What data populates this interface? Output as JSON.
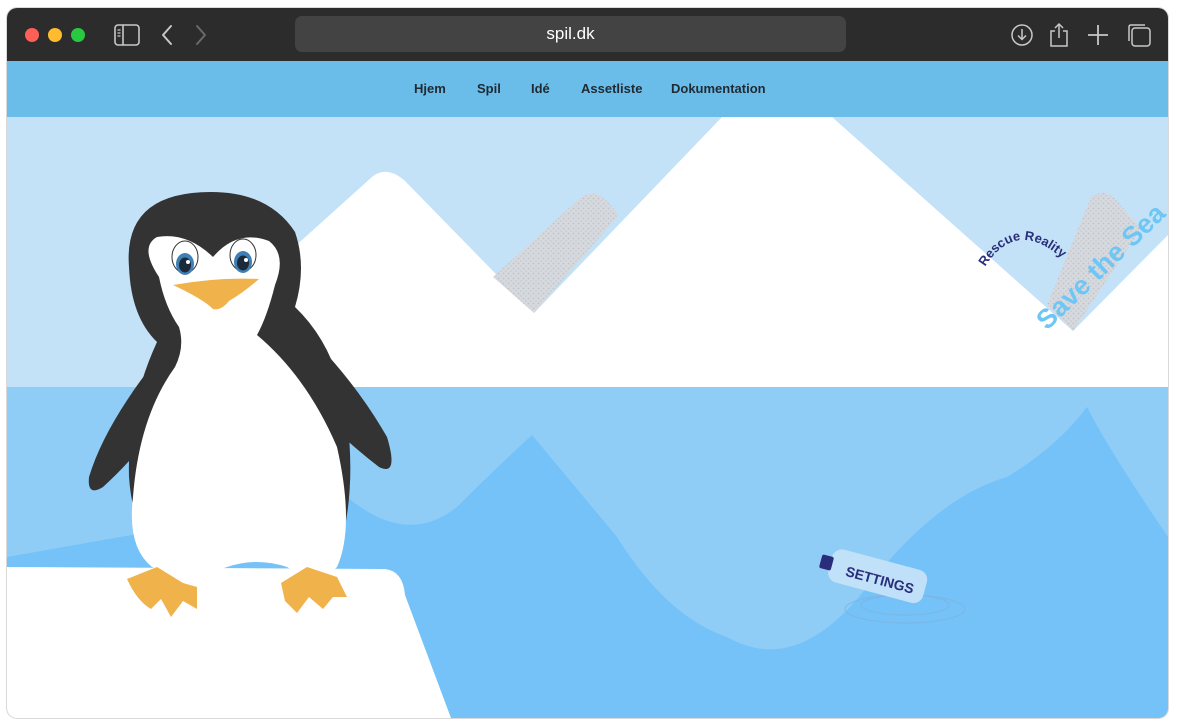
{
  "browser": {
    "url": "spil.dk",
    "icons": [
      "sidebar-icon",
      "back-icon",
      "forward-icon",
      "download-icon",
      "share-icon",
      "new-tab-icon",
      "tabs-overview-icon"
    ]
  },
  "nav": {
    "items": [
      {
        "label": "Hjem"
      },
      {
        "label": "Spil"
      },
      {
        "label": "Idé"
      },
      {
        "label": "Assetliste"
      },
      {
        "label": "Dokumentation"
      }
    ]
  },
  "logo": {
    "line1": "Rescue Reality",
    "line2": "Save the Sea"
  },
  "bottle": {
    "label": "SETTINGS"
  },
  "colors": {
    "titlebar": "#2d2c2c",
    "navbar": "#6bbde9",
    "sky": "#c3e2f8",
    "water": "#8fcdf7",
    "water_deep": "#74c2f8",
    "logo_dark": "#2a2e7a",
    "logo_light": "#6ec6f5"
  }
}
